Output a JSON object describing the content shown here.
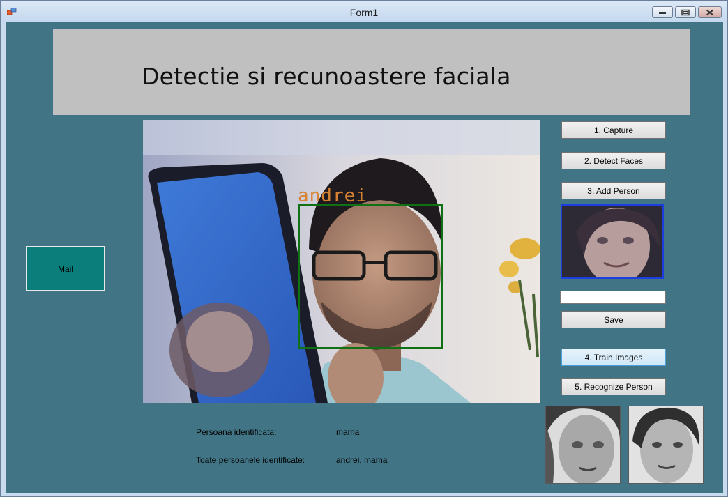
{
  "window": {
    "title": "Form1",
    "icons": {
      "app": "app-icon",
      "minimize": "minimize-icon",
      "restore": "restore-icon",
      "close": "close-icon"
    }
  },
  "header": {
    "title": "Detectie si recunoastere faciala"
  },
  "camera": {
    "face_label": "andrei"
  },
  "buttons": {
    "capture": "1. Capture",
    "detect": "2. Detect Faces",
    "add_person": "3. Add Person",
    "save": "Save",
    "train": "4. Train Images",
    "recognize": "5. Recognize Person",
    "mail": "Mail"
  },
  "name_input": {
    "value": ""
  },
  "results": {
    "identified_label": "Persoana identificata:",
    "identified_value": "mama",
    "all_label": "Toate persoanele identificate:",
    "all_value": "andrei, mama"
  },
  "colors": {
    "client_bg": "#417485",
    "header_bg": "#c0c0c0",
    "mail_bg": "#0b7d7a",
    "face_box": "#107014",
    "face_label": "#d98232",
    "thumb_border": "#1c3ee0"
  }
}
